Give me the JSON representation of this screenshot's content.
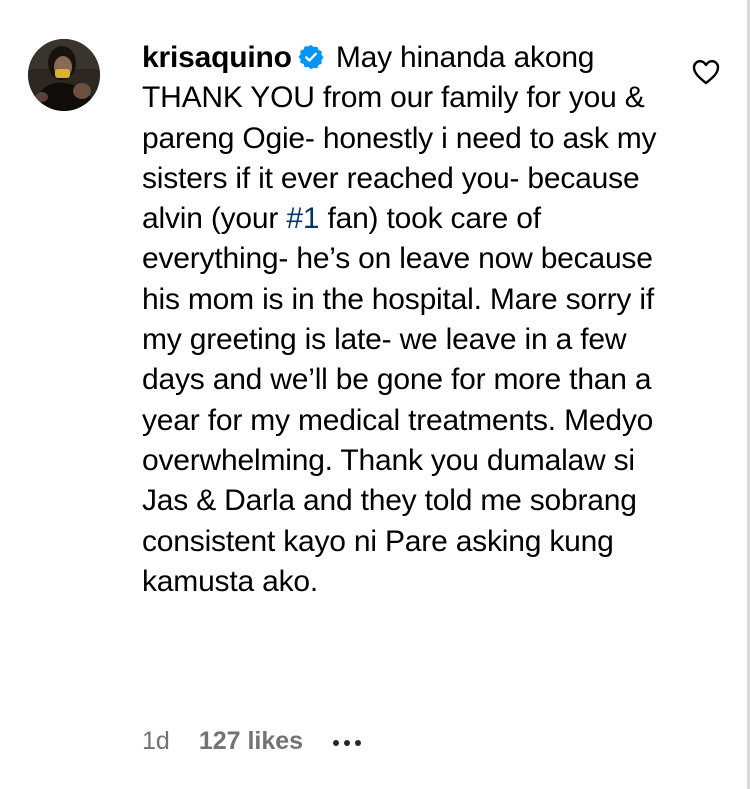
{
  "comment": {
    "username": "krisaquino",
    "verified": true,
    "text_before_hashtag": " May hinanda akong THANK YOU from our family for you & pareng Ogie- honestly i need to ask my sisters if it ever reached you- because alvin (your ",
    "hashtag": "#1",
    "text_after_hashtag": " fan) took care of everything- he’s on leave now because his mom is in the hospital. Mare sorry if my greeting is late- we leave in a few days and we’ll be gone for more than a year for my medical treatments. Medyo overwhelming. Thank you dumalaw si Jas & Darla and they told me sobrang consistent kayo ni Pare asking kung kamusta ako.",
    "timestamp": "1d",
    "likes": "127 likes"
  },
  "icons": {
    "avatar": "profile-avatar",
    "verified": "verified-badge-icon",
    "like": "heart-outline-icon",
    "more": "more-options-icon"
  },
  "colors": {
    "verified_blue": "#0095f6",
    "link": "#00376b",
    "meta_gray": "#737373"
  }
}
